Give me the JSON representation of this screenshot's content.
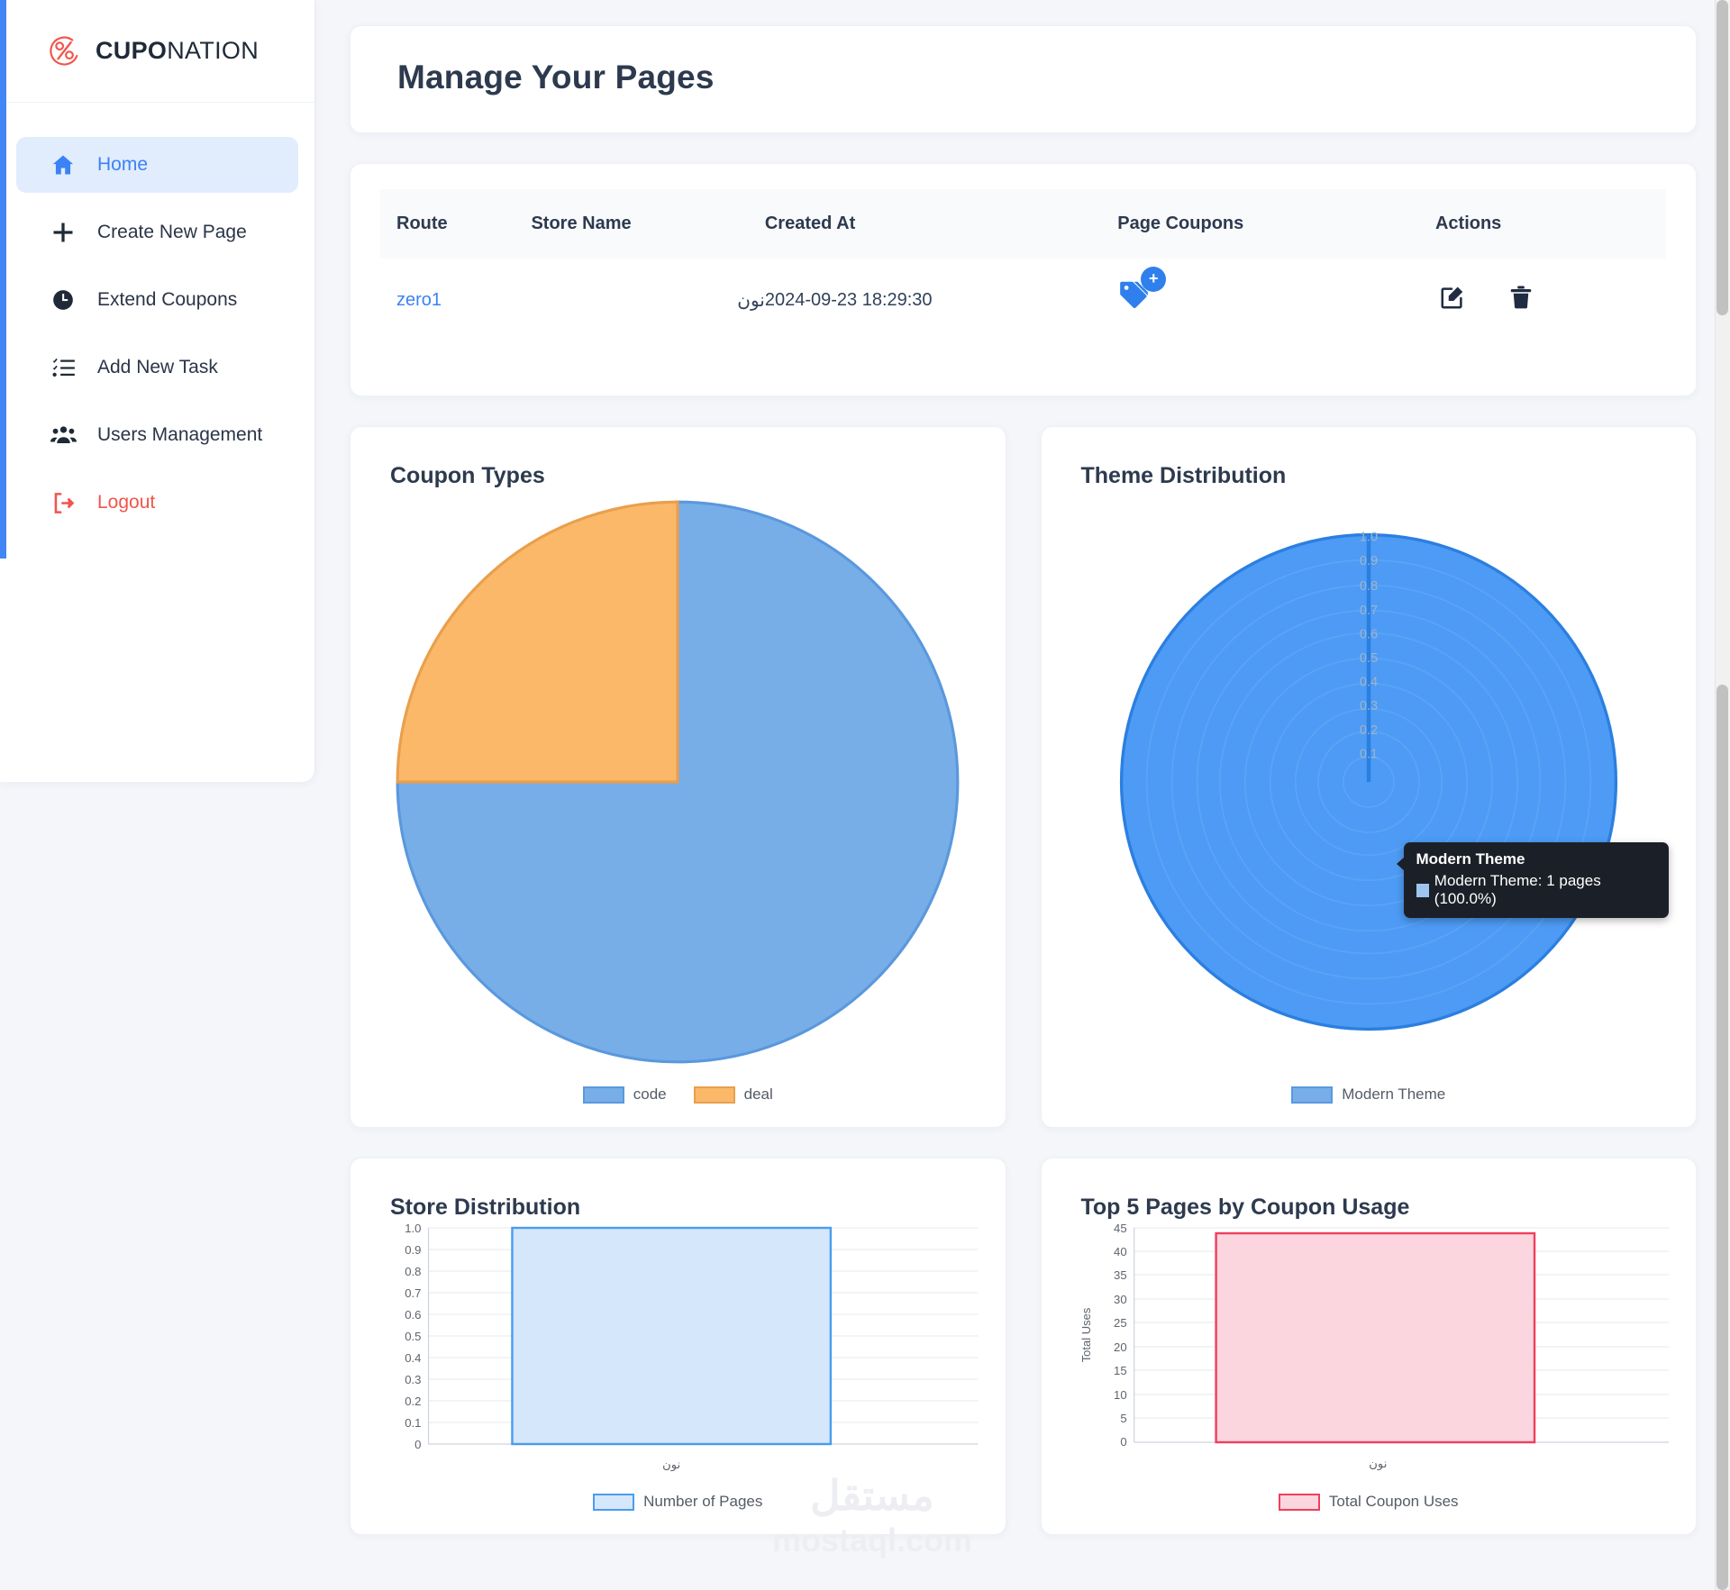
{
  "brand": {
    "name_bold": "CUPO",
    "name_thin": "NATION",
    "logo_icon": "percent-circle-logo"
  },
  "sidebar": {
    "items": [
      {
        "label": "Home",
        "icon": "home-icon",
        "active": true
      },
      {
        "label": "Create New Page",
        "icon": "plus-icon",
        "active": false
      },
      {
        "label": "Extend Coupons",
        "icon": "clock-icon",
        "active": false
      },
      {
        "label": "Add New Task",
        "icon": "task-list-icon",
        "active": false
      },
      {
        "label": "Users Management",
        "icon": "users-icon",
        "active": false
      },
      {
        "label": "Logout",
        "icon": "logout-icon",
        "active": false
      }
    ]
  },
  "header": {
    "title": "Manage Your Pages"
  },
  "table": {
    "columns": [
      "Route",
      "Store Name",
      "Created At",
      "Page Coupons",
      "Actions"
    ],
    "rows": [
      {
        "route": "zero1",
        "store_name": "نون",
        "created_at": "2024-09-23 18:29:30",
        "coupon_icon": "tag-icon",
        "add_coupon_badge": "+",
        "edit_icon": "edit-pencil-icon",
        "delete_icon": "trash-icon"
      }
    ]
  },
  "colors": {
    "accent_blue": "#4285f4",
    "link_blue": "#3b82f6",
    "logout_red": "#f1554c",
    "pie_code": "#77aee8",
    "pie_deal": "#fbb869",
    "radar_fill": "#4d9bf5",
    "bar_blue_border": "#4a9cf0",
    "bar_blue_fill": "#d5e7fb",
    "bar_pink_border": "#ef3f5e",
    "bar_pink_fill": "#fbd6de"
  },
  "charts": {
    "coupon_types": {
      "title": "Coupon Types"
    },
    "theme_distribution": {
      "title": "Theme Distribution",
      "tooltip": {
        "title": "Modern Theme",
        "text": "Modern Theme: 1 pages (100.0%)"
      }
    },
    "store_distribution": {
      "title": "Store Distribution"
    },
    "top_pages": {
      "title": "Top 5 Pages by Coupon Usage"
    }
  },
  "watermark": {
    "arabic": "مستقل",
    "latin": "mostaql.com"
  },
  "chart_data": [
    {
      "id": "coupon-types",
      "type": "pie",
      "title": "Coupon Types",
      "categories": [
        "code",
        "deal"
      ],
      "values": [
        75,
        25
      ],
      "value_unit": "percent",
      "colors": [
        "#77aee8",
        "#fbb869"
      ],
      "legend_position": "bottom",
      "legend": [
        "code",
        "deal"
      ]
    },
    {
      "id": "theme-distribution",
      "type": "radar",
      "title": "Theme Distribution",
      "categories": [
        "Modern Theme"
      ],
      "series": [
        {
          "name": "Modern Theme",
          "values": [
            1.0
          ]
        }
      ],
      "ylim": [
        0,
        1.0
      ],
      "yticks": [
        "0.1",
        "0.2",
        "0.3",
        "0.4",
        "0.5",
        "0.6",
        "0.7",
        "0.8",
        "0.9",
        "1.0"
      ],
      "grid": true,
      "legend_position": "bottom",
      "legend": [
        "Modern Theme"
      ],
      "colors": [
        "#4d9bf5"
      ],
      "annotation": "Modern Theme: 1 pages (100.0%)"
    },
    {
      "id": "store-distribution",
      "type": "bar",
      "title": "Store Distribution",
      "categories": [
        "نون"
      ],
      "values": [
        1.0
      ],
      "xlabel": "",
      "ylabel": "",
      "ylim": [
        0,
        1.0
      ],
      "yticks": [
        "1.0",
        "0.9",
        "0.8",
        "0.7",
        "0.6",
        "0.5",
        "0.4",
        "0.3",
        "0.2",
        "0.1",
        "0"
      ],
      "grid": true,
      "legend_position": "bottom",
      "legend": [
        "Number of Pages"
      ],
      "colors": [
        "#d5e7fb"
      ]
    },
    {
      "id": "top-pages",
      "type": "bar",
      "title": "Top 5 Pages by Coupon Usage",
      "categories": [
        "نون"
      ],
      "values": [
        44
      ],
      "xlabel": "",
      "ylabel": "Total Uses",
      "ylim": [
        0,
        45
      ],
      "yticks": [
        "45",
        "40",
        "35",
        "30",
        "25",
        "20",
        "15",
        "10",
        "5",
        "0"
      ],
      "grid": true,
      "legend_position": "bottom",
      "legend": [
        "Total Coupon Uses"
      ],
      "colors": [
        "#fbd6de"
      ]
    }
  ]
}
